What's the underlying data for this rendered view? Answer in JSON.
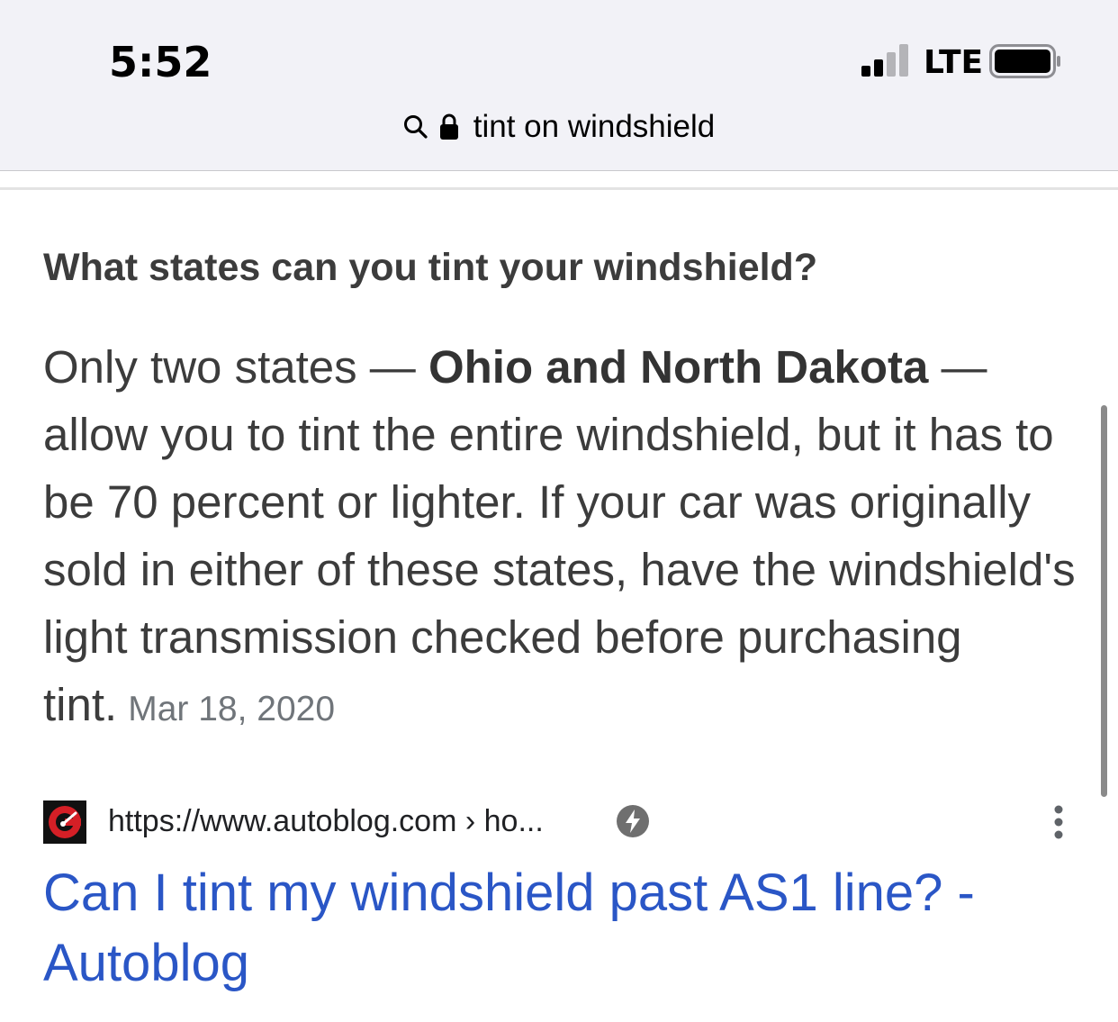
{
  "status_bar": {
    "time": "5:52",
    "network": "LTE",
    "signal_bars_active": 2,
    "signal_bars_total": 4,
    "battery_level": 0.95
  },
  "address_bar": {
    "url_text": "tint on windshield",
    "search_icon": "search-icon",
    "lock_icon": "lock-icon"
  },
  "snippet": {
    "question": "What states can you tint your windshield?",
    "answer_prefix": "Only two states — ",
    "answer_bold": "Ohio and North Dakota",
    "answer_suffix": " — allow you to tint the entire windshield, but it has to be 70 percent or lighter. If your car was originally sold in either of these states, have the windshield's light transmission checked before purchasing tint.",
    "date": "Mar 18, 2020"
  },
  "result": {
    "source_url": "https://www.autoblog.com › ho...",
    "favicon": "autoblog-favicon",
    "amp_icon": "amp-lightning-icon",
    "more_icon": "more-vert-icon",
    "title": "Can I tint my windshield past AS1 line? - Autoblog"
  },
  "colors": {
    "link": "#2a56c6",
    "text": "#3c3c3c",
    "muted": "#70757a",
    "topbar_bg": "#f2f2f7"
  }
}
